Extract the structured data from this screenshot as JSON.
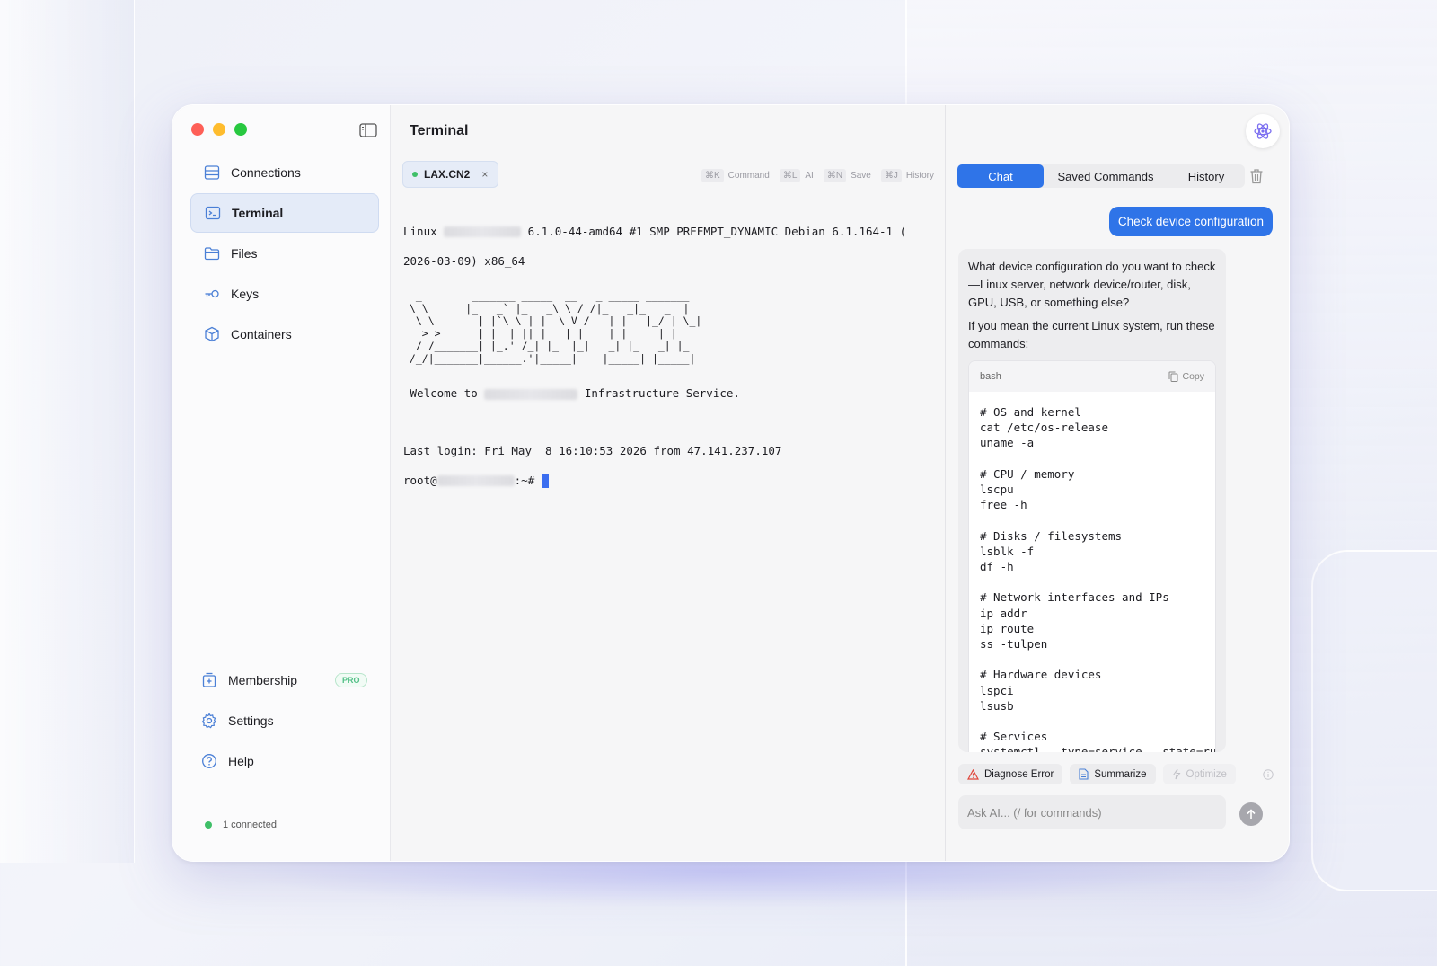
{
  "sidebar": {
    "nav": [
      {
        "label": "Connections",
        "icon": "server-icon"
      },
      {
        "label": "Terminal",
        "icon": "terminal-icon",
        "active": true
      },
      {
        "label": "Files",
        "icon": "folder-icon"
      },
      {
        "label": "Keys",
        "icon": "key-icon"
      },
      {
        "label": "Containers",
        "icon": "box-icon"
      }
    ],
    "bottom": [
      {
        "label": "Membership",
        "icon": "membership-icon",
        "badge": "PRO"
      },
      {
        "label": "Settings",
        "icon": "gear-icon"
      },
      {
        "label": "Help",
        "icon": "help-icon"
      }
    ],
    "status": "1 connected"
  },
  "terminal": {
    "title": "Terminal",
    "tab": {
      "name": "LAX.CN2",
      "close": "×"
    },
    "shortcuts": [
      {
        "key": "⌘K",
        "label": "Command"
      },
      {
        "key": "⌘L",
        "label": "AI"
      },
      {
        "key": "⌘N",
        "label": "Save"
      },
      {
        "key": "⌘J",
        "label": "History"
      }
    ],
    "line1_prefix": "Linux ",
    "line1_suffix": " 6.1.0-44-amd64 #1 SMP PREEMPT_DYNAMIC Debian 6.1.164-1 (",
    "line2": "2026-03-09) x86_64",
    "ascii_art": "  _        _______ _____  __   _ _____ _______\n \\ \\      |_   _` |_   _\\ \\ / /|_   _|_   _  |\n  \\ \\       | |`\\ \\ | |  \\ V /   | |   |_/ | \\_|\n   > >      | |  | || |   | |    | |     | |\n  / /_______| |_.' /_| |_  |_|   _| |_   _| |_\n /_/|_______|______.'|_____|    |_____| |_____|",
    "welcome_prefix": " Welcome to ",
    "welcome_suffix": " Infrastructure Service.",
    "last_login": "Last login: Fri May  8 16:10:53 2026 from 47.141.237.107",
    "prompt_prefix": "root@",
    "prompt_suffix": ":~# "
  },
  "chat": {
    "tabs": {
      "chat": "Chat",
      "saved": "Saved Commands",
      "history": "History"
    },
    "user_message": "Check device configuration",
    "ai_intro": "What device configuration do you want to check—Linux server, network device/router, disk, GPU, USB, or something else?",
    "ai_run": "If you mean the current Linux system, run these commands:",
    "code_lang": "bash",
    "copy_label": "Copy",
    "code": "# OS and kernel\ncat /etc/os-release\nuname -a\n\n# CPU / memory\nlscpu\nfree -h\n\n# Disks / filesystems\nlsblk -f\ndf -h\n\n# Network interfaces and IPs\nip addr\nip route\nss -tulpen\n\n# Hardware devices\nlspci\nlsusb\n\n# Services\nsystemctl --type=service --state=running",
    "actions": {
      "diagnose": "Diagnose Error",
      "summarize": "Summarize",
      "optimize": "Optimize"
    },
    "input_placeholder": "Ask AI... (/ for commands)"
  },
  "colors": {
    "accent": "#2f74e8",
    "active_nav": "#e4ebf8",
    "status_green": "#3fbf68",
    "pro_green": "#53c087"
  }
}
